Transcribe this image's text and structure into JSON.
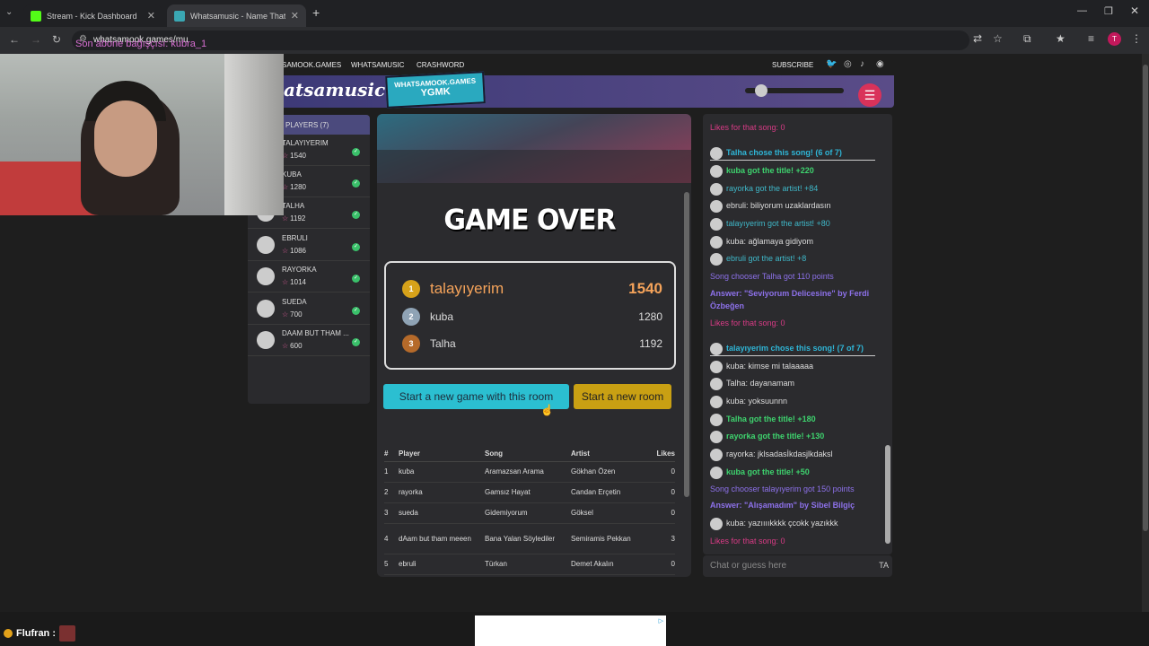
{
  "browser": {
    "tabs": [
      {
        "title": "Stream - Kick Dashboard",
        "icon": "kick-icon",
        "active": false
      },
      {
        "title": "Whatsamusic - Name That Tune",
        "icon": "whatsamusic-icon",
        "active": true
      }
    ],
    "url": "whatsamook.games/mu"
  },
  "stream_overlay": {
    "text": "Son abone bağışçısı: kubra_1",
    "chat_user": "Flufran :"
  },
  "site_nav": {
    "items": [
      "SAMOOK.GAMES",
      "WHATSAMUSIC",
      "CRASHWORD"
    ],
    "subscribe": "SUBSCRIBE",
    "social_icons": [
      "twitter-icon",
      "instagram-icon",
      "tiktok-icon",
      "discord-icon"
    ]
  },
  "header": {
    "logo": "atsamusic",
    "sponsor_line1": "WHATSAMOOK.GAMES",
    "sponsor_line2": "YGMK",
    "volume": 0.1
  },
  "players": {
    "title": "PLAYERS (7)",
    "list": [
      {
        "name": "TALAYIYERIM",
        "score": "1540"
      },
      {
        "name": "KUBA",
        "score": "1280"
      },
      {
        "name": "TALHA",
        "score": "1192"
      },
      {
        "name": "EBRULI",
        "score": "1086"
      },
      {
        "name": "RAYORKA",
        "score": "1014"
      },
      {
        "name": "SUEDA",
        "score": "700"
      },
      {
        "name": "DAAM BUT THAM ...",
        "score": "600"
      }
    ]
  },
  "game": {
    "title": "GAME OVER",
    "podium": [
      {
        "name": "talayıyerim",
        "score": "1540",
        "medal": "gold-medal-icon"
      },
      {
        "name": "kuba",
        "score": "1280",
        "medal": "silver-medal-icon"
      },
      {
        "name": "Talha",
        "score": "1192",
        "medal": "bronze-medal-icon"
      }
    ],
    "btn_same_room": "Start a new game with this room",
    "btn_new_room": "Start a new room",
    "table": {
      "headers": [
        "#",
        "Player",
        "Song",
        "Artist",
        "Likes"
      ],
      "rows": [
        [
          "1",
          "kuba",
          "Aramazsan Arama",
          "Gökhan Özen",
          "0"
        ],
        [
          "2",
          "rayorka",
          "Gamsız Hayat",
          "Candan Erçetin",
          "0"
        ],
        [
          "3",
          "sueda",
          "Gidemiyorum",
          "Göksel",
          "0"
        ],
        [
          "4",
          "dAam but tham meeen",
          "Bana Yalan Söylediler",
          "Semiramis Pekkan",
          "3"
        ],
        [
          "5",
          "ebruli",
          "Türkan",
          "Demet Akalın",
          "0"
        ]
      ]
    }
  },
  "chat": {
    "messages": [
      {
        "text": "Likes for that song: 0",
        "style": "pink",
        "avatar": false
      },
      {
        "text": "Talha chose this song! (6 of 7)",
        "style": "chooser",
        "avatar": true
      },
      {
        "text": "kuba got the title! +220",
        "style": "green",
        "avatar": true
      },
      {
        "text": "rayorka got the artist! +84",
        "style": "teal",
        "avatar": true
      },
      {
        "text": "ebruli: biliyorum uzaklardasın",
        "style": "normal",
        "avatar": true
      },
      {
        "text": "talayıyerim got the artist! +80",
        "style": "teal",
        "avatar": true
      },
      {
        "text": "kuba: ağlamaya gidiyom",
        "style": "normal",
        "avatar": true
      },
      {
        "text": "ebruli got the artist! +8",
        "style": "teal",
        "avatar": true
      },
      {
        "text": "Song chooser Talha got 110 points",
        "style": "purple",
        "avatar": false
      },
      {
        "text": "Answer: \"Seviyorum Delicesine\" by Ferdi Özbeğen",
        "style": "purpleb",
        "avatar": false
      },
      {
        "text": "Likes for that song: 0",
        "style": "pink",
        "avatar": false
      },
      {
        "text": "talayıyerim chose this song! (7 of 7)",
        "style": "chooser",
        "avatar": true
      },
      {
        "text": "kuba: kimse mi talaaaaa",
        "style": "normal",
        "avatar": true
      },
      {
        "text": "Talha: dayanamam",
        "style": "normal",
        "avatar": true
      },
      {
        "text": "kuba: yoksuunnn",
        "style": "normal",
        "avatar": true
      },
      {
        "text": "Talha got the title! +180",
        "style": "green",
        "avatar": true
      },
      {
        "text": "rayorka got the title! +130",
        "style": "green",
        "avatar": true
      },
      {
        "text": "rayorka: jklsadasİkdasjlkdaksl",
        "style": "normal",
        "avatar": true
      },
      {
        "text": "kuba got the title! +50",
        "style": "green",
        "avatar": true
      },
      {
        "text": "Song chooser talayıyerim got 150 points",
        "style": "purple",
        "avatar": false
      },
      {
        "text": "Answer: \"Alışamadım\" by Sibel Bilgiç",
        "style": "purpleb",
        "avatar": false
      },
      {
        "text": "kuba: yazııııkkkk çcokk yazıkkk",
        "style": "normal",
        "avatar": true
      },
      {
        "text": "Likes for that song: 0",
        "style": "pink",
        "avatar": false
      }
    ],
    "input_placeholder": "Chat or guess here",
    "input_icon": "TA"
  },
  "colors": {
    "accent_cyan": "#2bbfd1",
    "accent_gold": "#c9a013",
    "gold_text": "#f5a35a",
    "header": "#4b4a7d"
  }
}
